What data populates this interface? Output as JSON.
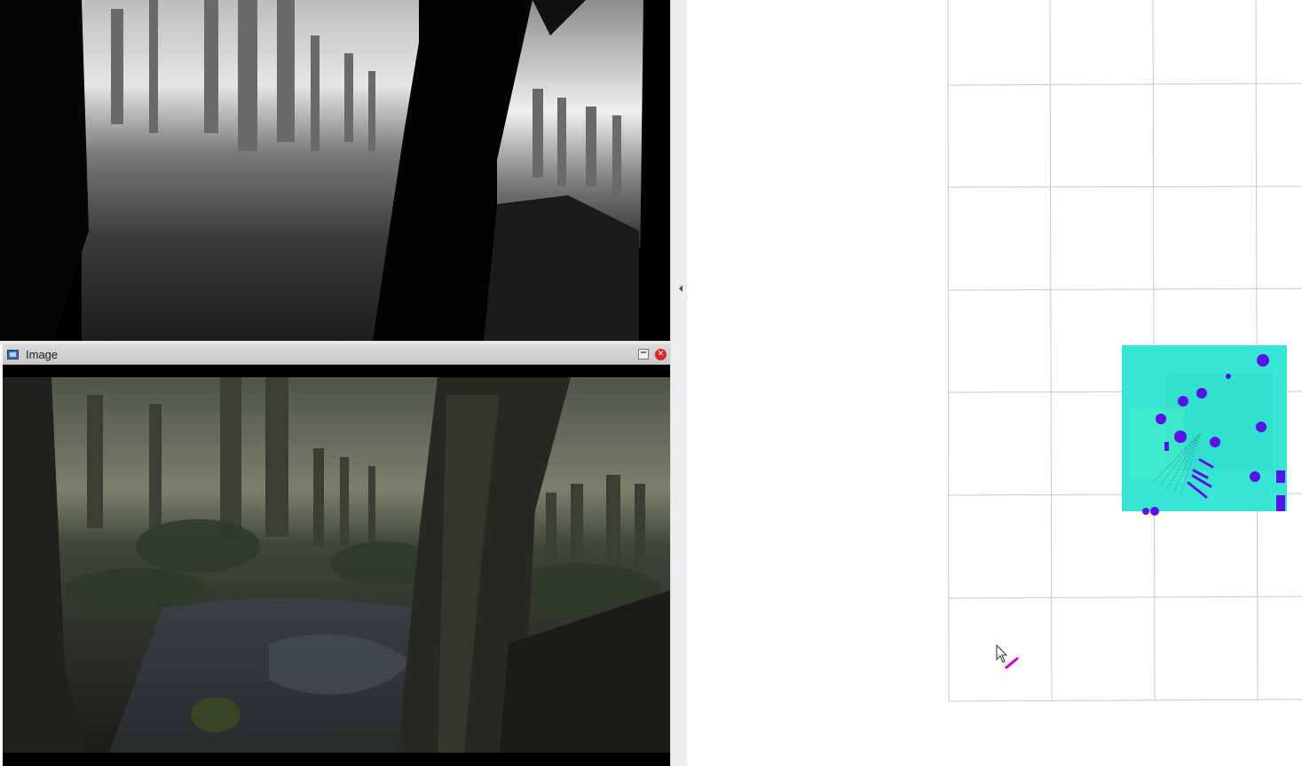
{
  "image_window": {
    "title": "Image",
    "app_icon": "image-viewer-icon",
    "maximize_icon": "maximize-icon",
    "close_icon": "close-icon",
    "close_glyph": "✕"
  },
  "splitter": {
    "collapse_icon": "chevron-left-icon"
  },
  "viewport": {
    "grid_color": "#c8c8c8",
    "costmap_colors": {
      "free": "#35e8d4",
      "obstacle": "#5a12e6",
      "edge": "#1a22ff"
    },
    "robot_marker_color": "#d400d4",
    "cursor_icon": "mouse-pointer-icon"
  }
}
